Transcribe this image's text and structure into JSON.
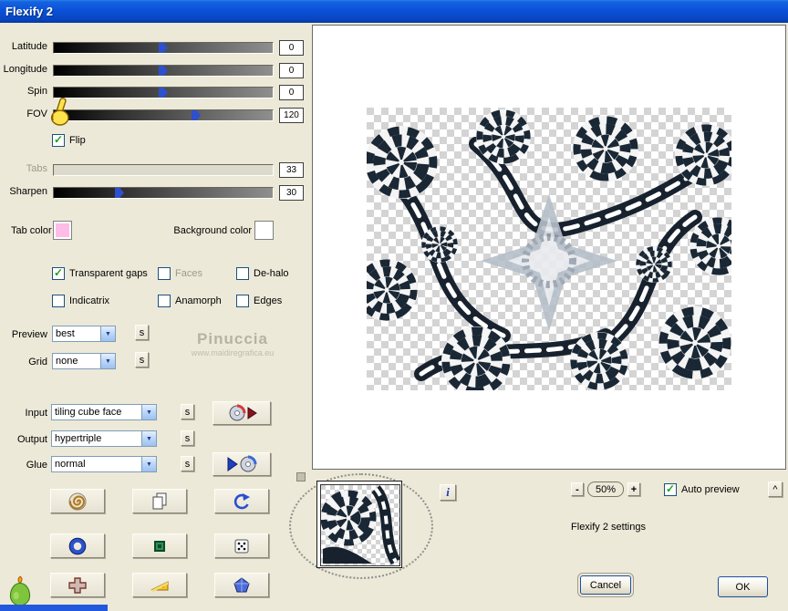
{
  "window": {
    "title": "Flexify 2"
  },
  "glyphs": {
    "check": "✓",
    "dropdown_arrow": "▼",
    "caret": "^",
    "minus": "-",
    "plus": "+",
    "info": "i"
  },
  "theme": {
    "titlebar_blue": "#0a50d8",
    "dialog_face": "#ece9d8",
    "slider_thumb_blue": "#2d50cc"
  },
  "sliders": {
    "latitude": {
      "label": "Latitude",
      "value": "0"
    },
    "longitude": {
      "label": "Longitude",
      "value": "0"
    },
    "spin": {
      "label": "Spin",
      "value": "0"
    },
    "fov": {
      "label": "FOV",
      "value": "120"
    },
    "tabs": {
      "label": "Tabs",
      "value": "33"
    },
    "sharpen": {
      "label": "Sharpen",
      "value": "30"
    }
  },
  "checkboxes": {
    "flip": "Flip",
    "transparent_gaps": "Transparent gaps",
    "faces": "Faces",
    "dehalo": "De-halo",
    "indicatrix": "Indicatrix",
    "anamorph": "Anamorph",
    "edges": "Edges",
    "auto_preview": "Auto preview"
  },
  "color_fields": {
    "tab_label": "Tab color",
    "tab_color": "#ffbce6",
    "background_label": "Background color",
    "background_color": "#ffffff"
  },
  "dropdowns": {
    "preview": {
      "label": "Preview",
      "value": "best"
    },
    "grid": {
      "label": "Grid",
      "value": "none"
    },
    "input": {
      "label": "Input",
      "value": "tiling cube face"
    },
    "output": {
      "label": "Output",
      "value": "hypertriple"
    },
    "glue": {
      "label": "Glue",
      "value": "normal"
    }
  },
  "s_button": "s",
  "watermark": {
    "name": "Pinuccia",
    "url": "www.maidiregrafica.eu"
  },
  "zoom": {
    "level": "50%"
  },
  "status_text": "Flexify 2 settings",
  "actions": {
    "cancel": "Cancel",
    "ok": "OK"
  }
}
